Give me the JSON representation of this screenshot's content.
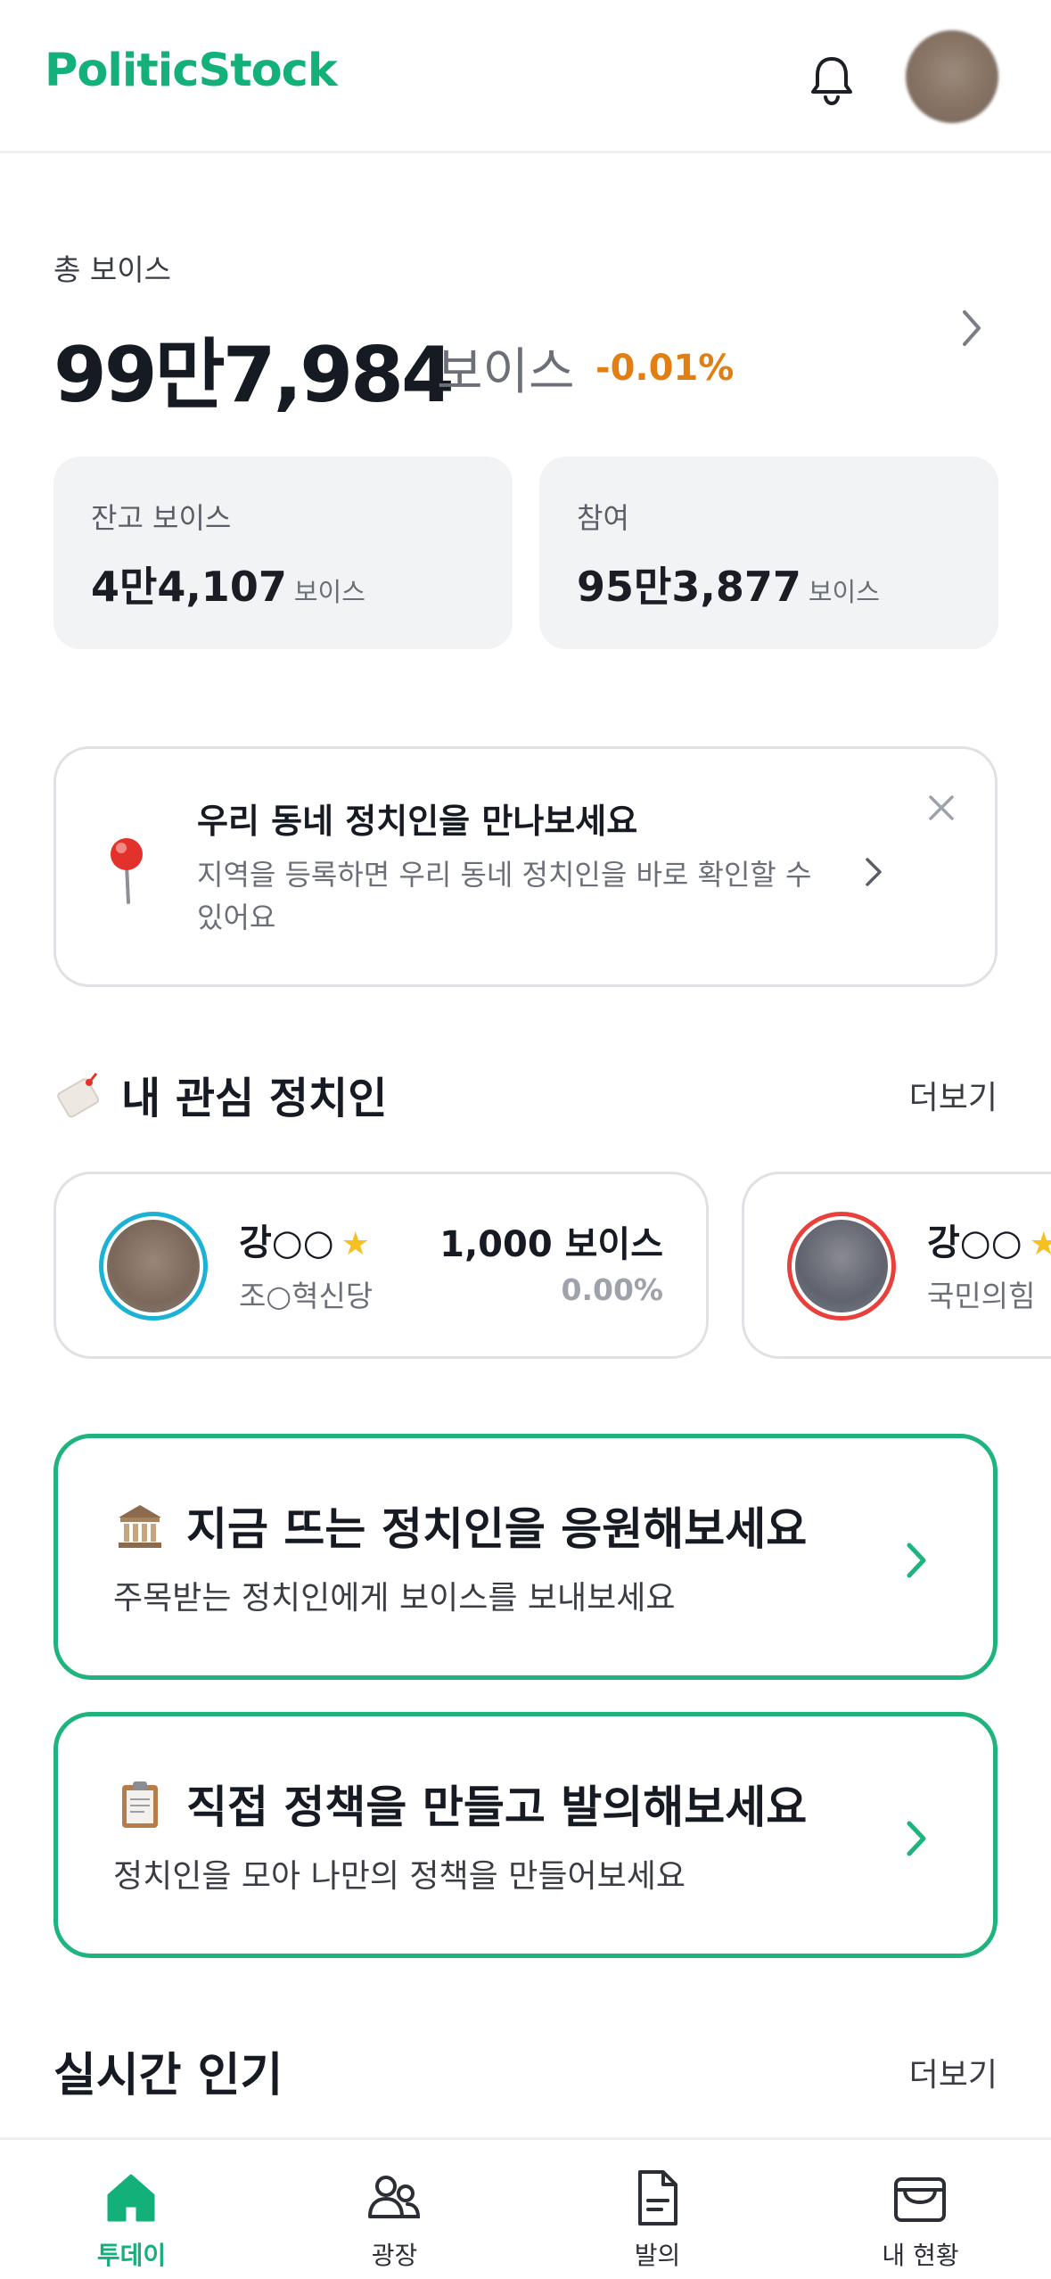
{
  "header": {
    "logo": "PoliticStock",
    "icons": [
      "bell-icon",
      "avatar"
    ]
  },
  "balance": {
    "label": "총 보이스",
    "value": "99만7,984",
    "unit": "보이스",
    "change": "-0.01%",
    "change_color": "#e17f12"
  },
  "stats": {
    "remaining": {
      "label": "잔고 보이스",
      "value": "4만4,107",
      "unit": "보이스"
    },
    "participation": {
      "label": "참여",
      "value": "95만3,877",
      "unit": "보이스"
    }
  },
  "banner": {
    "title": "우리 동네 정치인을 만나보세요",
    "description": "지역을 등록하면 우리 동네 정치인을 바로 확인할 수 있어요",
    "icon": "pin-icon"
  },
  "favorites": {
    "title": "내 관심 정치인",
    "more": "더보기",
    "items": [
      {
        "name": "강○○",
        "party": "조○혁신당",
        "voice": "1,000 보이스",
        "change": "0.00%",
        "ring_color": "#1ab3d6"
      },
      {
        "name": "강○○",
        "party": "국민의힘",
        "ring_color": "#e8413c"
      }
    ]
  },
  "promos": [
    {
      "title": "지금 뜨는 정치인을 응원해보세요",
      "description": "주목받는 정치인에게 보이스를 보내보세요",
      "icon": "classical-building-icon"
    },
    {
      "title": "직접 정책을 만들고 발의해보세요",
      "description": "정치인을 모아 나만의 정책을 만들어보세요",
      "icon": "clipboard-icon"
    }
  ],
  "realtime": {
    "title": "실시간 인기",
    "more": "더보기"
  },
  "nav": {
    "items": [
      {
        "label": "투데이",
        "icon": "home-icon",
        "active": true
      },
      {
        "label": "광장",
        "icon": "people-icon",
        "active": false
      },
      {
        "label": "발의",
        "icon": "document-icon",
        "active": false
      },
      {
        "label": "내 현황",
        "icon": "wallet-icon",
        "active": false
      }
    ],
    "accent": "#14b07a"
  },
  "accent": "#1fb37e"
}
